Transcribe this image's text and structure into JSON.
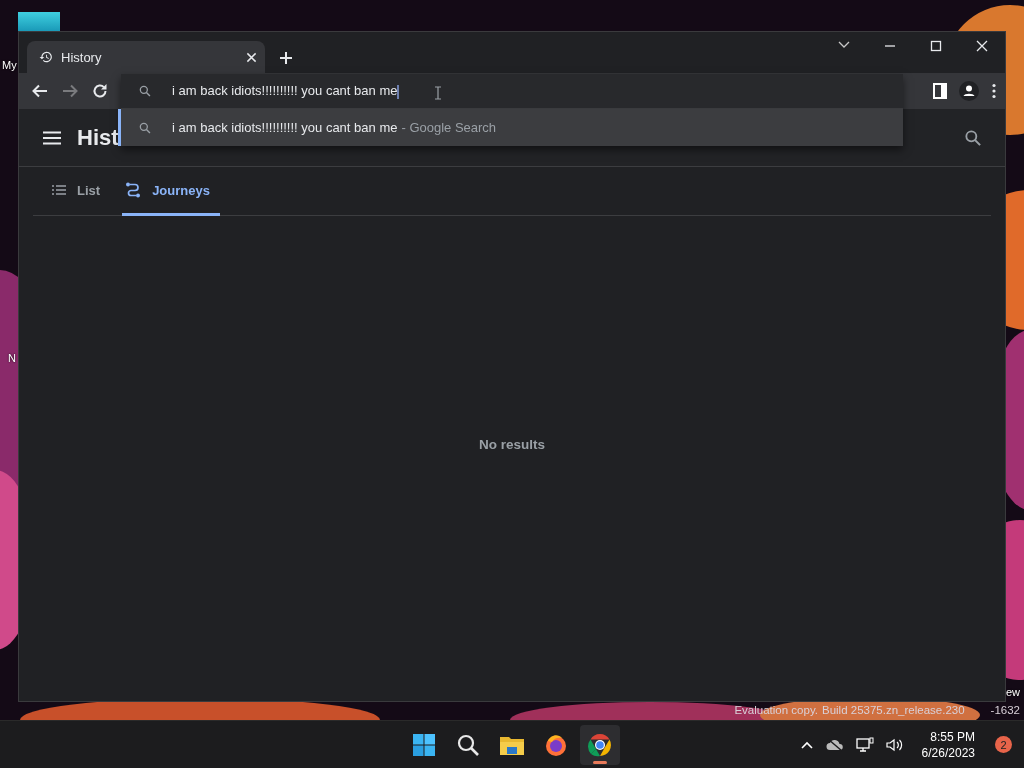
{
  "desktop": {
    "labels": [
      "My",
      "N",
      "ew"
    ],
    "watermark": [
      "Evaluation copy.",
      "Build 25375.zn_release.230",
      "-1632"
    ]
  },
  "window": {
    "tab": {
      "title": "History",
      "selected": true
    },
    "toolbar": {
      "forward": {
        "disabled": true
      },
      "omnibox": {
        "value": "i am back idiots!!!!!!!!!! you cant ban me"
      }
    },
    "suggestions": [
      {
        "text": "i am back idiots!!!!!!!!!! you cant ban me",
        "source": "- Google Search",
        "selected": true
      }
    ],
    "page": {
      "title": "Hist",
      "tabs": [
        {
          "label": "List",
          "selected": false
        },
        {
          "label": "Journeys",
          "selected": true
        }
      ],
      "empty_message": "No results"
    }
  },
  "taskbar": {
    "apps": [
      {
        "kind": "start",
        "selected": false
      },
      {
        "kind": "search",
        "selected": false
      },
      {
        "kind": "files",
        "selected": false
      },
      {
        "kind": "firefox",
        "selected": false
      },
      {
        "kind": "chrome",
        "selected": true
      }
    ],
    "time": "8:55 PM",
    "date": "6/26/2023",
    "notification_count": "2"
  }
}
